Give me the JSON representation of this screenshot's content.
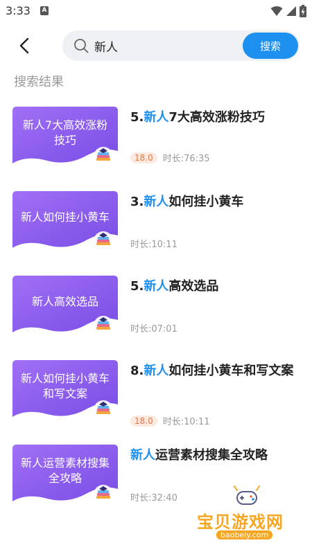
{
  "status_bar": {
    "time": "3:33",
    "notif_letter": "A"
  },
  "search": {
    "query": "新人",
    "placeholder": "",
    "button_label": "搜索"
  },
  "results_heading": "搜索结果",
  "results": [
    {
      "thumb_text": "新人7大高效涨粉技巧",
      "prefix": "5.",
      "highlight": "新人",
      "rest": "7大高效涨粉技巧",
      "badge": "18.0",
      "duration": "时长:76:35"
    },
    {
      "thumb_text": "新人如何挂小黄车",
      "prefix": "3.",
      "highlight": "新人",
      "rest": "如何挂小黄车",
      "badge": null,
      "duration": "时长:10:11"
    },
    {
      "thumb_text": "新人高效选品",
      "prefix": "5.",
      "highlight": "新人",
      "rest": "高效选品",
      "badge": null,
      "duration": "时长:07:01"
    },
    {
      "thumb_text": "新人如何挂小黄车和写文案",
      "prefix": "8.",
      "highlight": "新人",
      "rest": "如何挂小黄车和写文案",
      "badge": "18.0",
      "duration": "时长:10:11"
    },
    {
      "thumb_text": "新人运营素材搜集全攻略",
      "prefix": "",
      "highlight": "新人",
      "rest": "运营素材搜集全攻略",
      "badge": null,
      "duration": "时长:32:40"
    }
  ],
  "watermark": {
    "name": "宝贝游戏网",
    "url": "baobeiy.com"
  },
  "colors": {
    "accent": "#1e90f0",
    "thumb_gradient_start": "#9b6cf3",
    "thumb_gradient_end": "#7b4fe6",
    "badge_text": "#e8743b",
    "badge_bg": "#fde9df"
  }
}
